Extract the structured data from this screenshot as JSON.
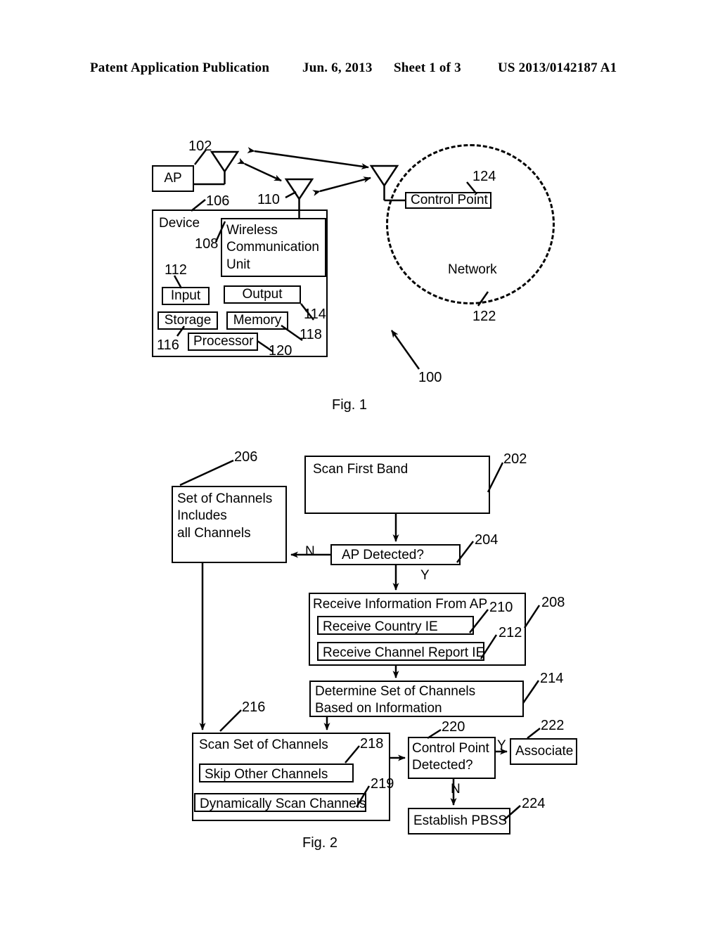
{
  "header": {
    "publication": "Patent Application Publication",
    "date": "Jun. 6, 2013",
    "sheet": "Sheet 1 of 3",
    "number": "US 2013/0142187 A1"
  },
  "figure1": {
    "caption": "Fig. 1",
    "system_ref": "100",
    "ap": {
      "label": "AP",
      "antenna_ref": "102"
    },
    "device": {
      "label": "Device",
      "ref": "106",
      "antenna_ref": "110",
      "blocks": [
        {
          "label": "Wireless\nCommunication\nUnit",
          "ref": "108"
        },
        {
          "label": "Input",
          "ref": "112"
        },
        {
          "label": "Output",
          "ref": "114"
        },
        {
          "label": "Storage",
          "ref": "116"
        },
        {
          "label": "Memory",
          "ref": "118"
        },
        {
          "label": "Processor",
          "ref": "120"
        }
      ]
    },
    "network": {
      "label": "Network",
      "ref": "122",
      "control_point": {
        "label": "Control Point",
        "ref": "124"
      }
    }
  },
  "figure2": {
    "caption": "Fig. 2",
    "nodes": [
      {
        "id": "scan_first_band",
        "label": "Scan First Band",
        "ref": "202"
      },
      {
        "id": "ap_detected",
        "label": "AP Detected?",
        "ref": "204"
      },
      {
        "id": "set_of_channels",
        "label": "Set of Channels\nIncludes\nall Channels",
        "ref": "206"
      },
      {
        "id": "receive_info",
        "label": "Receive Information From AP",
        "ref": "208"
      },
      {
        "id": "receive_country",
        "label": "Receive Country IE",
        "ref": "210"
      },
      {
        "id": "receive_chanrep",
        "label": "Receive Channel Report IE",
        "ref": "212"
      },
      {
        "id": "determine_set",
        "label": "Determine Set of Channels\nBased on Information",
        "ref": "214"
      },
      {
        "id": "scan_set",
        "label": "Scan Set of Channels",
        "ref": "216"
      },
      {
        "id": "skip_other",
        "label": "Skip Other Channels",
        "ref": "218"
      },
      {
        "id": "dynamic_scan",
        "label": "Dynamically Scan Channels",
        "ref": "219"
      },
      {
        "id": "cp_detected",
        "label": "Control Point\nDetected?",
        "ref": "220"
      },
      {
        "id": "associate",
        "label": "Associate",
        "ref": "222"
      },
      {
        "id": "establish_pbss",
        "label": "Establish PBSS",
        "ref": "224"
      }
    ],
    "edge_labels": {
      "ap_detected_no": "N",
      "ap_detected_yes": "Y",
      "cp_detected_yes": "Y",
      "cp_detected_no": "N"
    }
  }
}
